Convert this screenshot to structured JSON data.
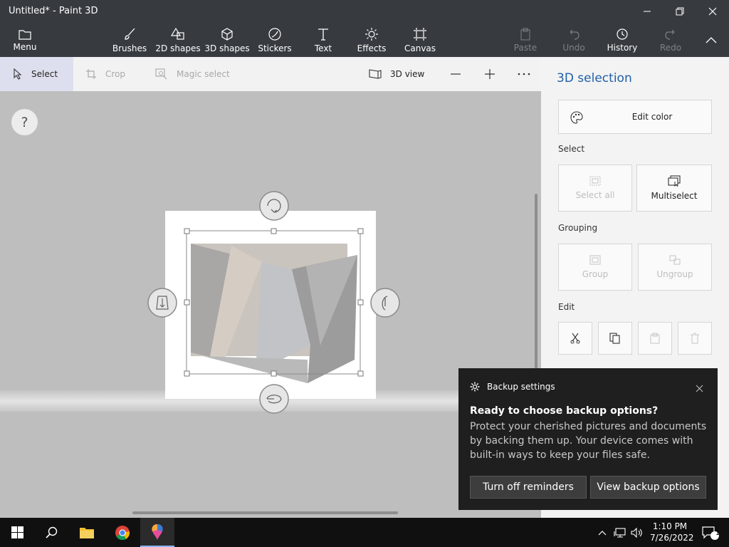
{
  "window": {
    "title": "Untitled* - Paint 3D"
  },
  "ribbon": {
    "menu": "Menu",
    "items": [
      "Brushes",
      "2D shapes",
      "3D shapes",
      "Stickers",
      "Text",
      "Effects",
      "Canvas"
    ],
    "paste": "Paste",
    "undo": "Undo",
    "history": "History",
    "redo": "Redo"
  },
  "toolbar": {
    "select": "Select",
    "crop": "Crop",
    "magic_select": "Magic select",
    "view3d": "3D view"
  },
  "canvas": {
    "help": "?"
  },
  "panel": {
    "title": "3D selection",
    "edit_color": "Edit color",
    "select_label": "Select",
    "select_all": "Select all",
    "multiselect": "Multiselect",
    "grouping_label": "Grouping",
    "group": "Group",
    "ungroup": "Ungroup",
    "edit_label": "Edit"
  },
  "toast": {
    "app": "Backup settings",
    "heading": "Ready to choose backup options?",
    "body": "Protect your cherished pictures and documents by backing them up. Your device comes with built-in ways to keep your files safe.",
    "btn_off": "Turn off reminders",
    "btn_view": "View backup options"
  },
  "taskbar": {
    "time": "1:10 PM",
    "date": "7/26/2022",
    "notifications": "1"
  },
  "colors": {
    "accent": "#1f5fa7",
    "chrome": "#373b40",
    "toast": "#1f1f1f"
  }
}
